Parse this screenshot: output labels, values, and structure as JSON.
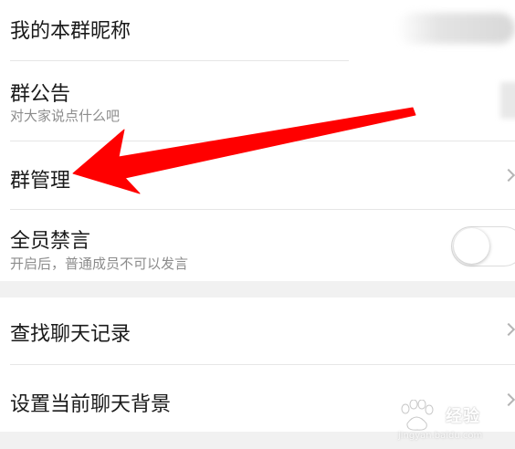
{
  "settings": {
    "nickname": {
      "label": "我的本群昵称"
    },
    "announcement": {
      "label": "群公告",
      "sublabel": "对大家说点什么吧"
    },
    "management": {
      "label": "群管理"
    },
    "mute_all": {
      "label": "全员禁言",
      "sublabel": "开启后，普通成员不可以发言",
      "enabled": false
    },
    "search_history": {
      "label": "查找聊天记录"
    },
    "chat_background": {
      "label": "设置当前聊天背景"
    }
  },
  "annotation": {
    "color": "#ff0000",
    "icon": "red-arrow-icon"
  },
  "watermark": {
    "text": "经验",
    "url": "jingyan.baidu.com"
  },
  "colors": {
    "background": "#ffffff",
    "section_gap": "#f1f1f1",
    "divider": "#e6e6e6",
    "text_primary": "#1a1a1a",
    "text_secondary": "#8c8c8c"
  }
}
